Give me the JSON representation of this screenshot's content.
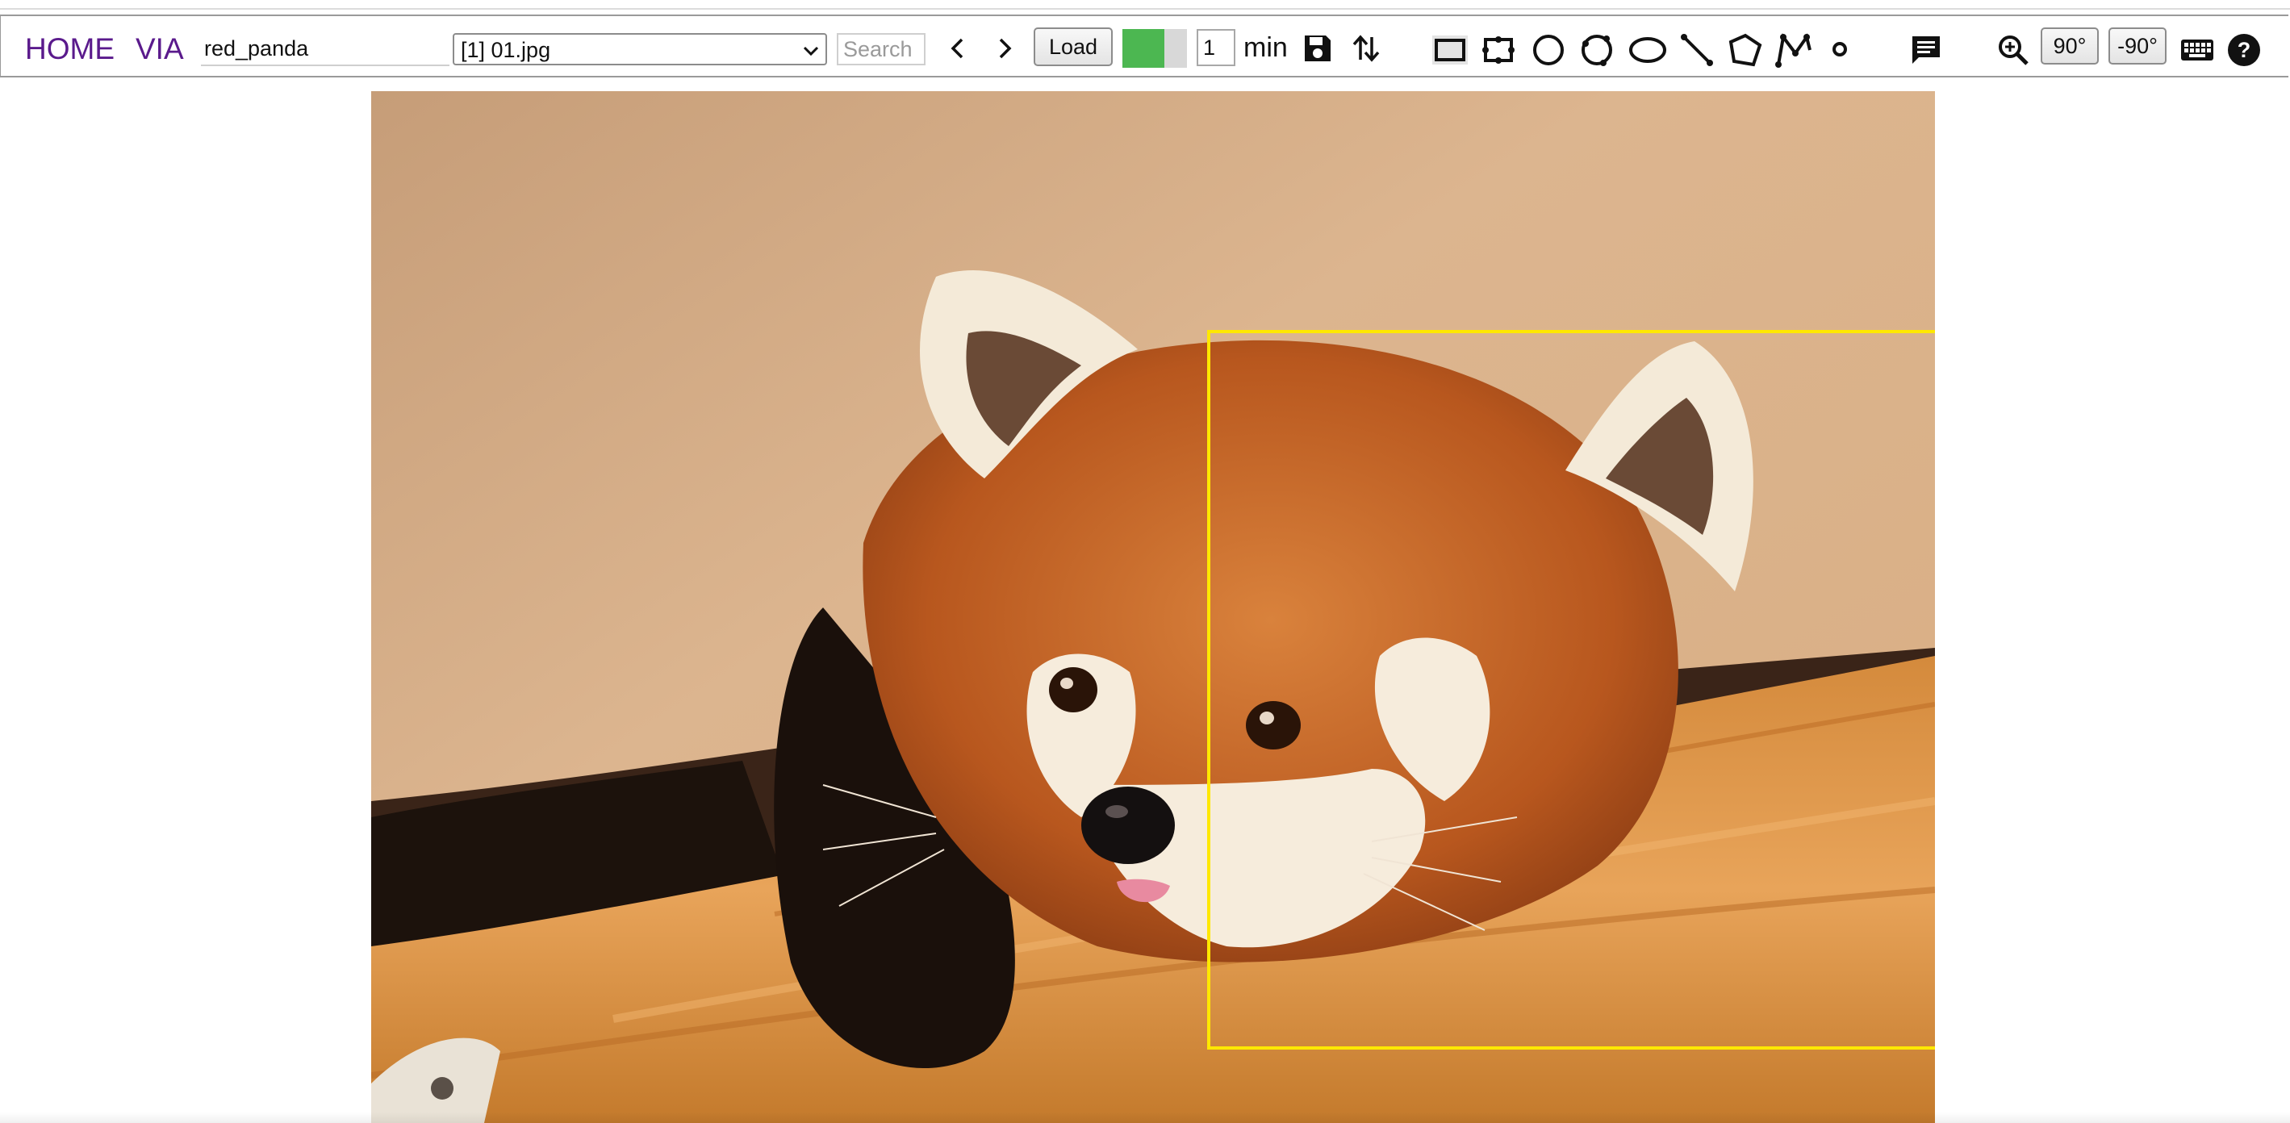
{
  "nav": {
    "home_label": "HOME",
    "via_label": "VIA"
  },
  "project": {
    "name_value": "red_panda"
  },
  "file_select": {
    "selected": "[1] 01.jpg"
  },
  "search": {
    "placeholder": "Search"
  },
  "toolbar": {
    "load_label": "Load",
    "region_color_primary": "#4cb751",
    "region_color_secondary": "#d8d8d8",
    "duration_value": "1",
    "duration_unit": "min",
    "rotate_cw_label": "90°",
    "rotate_ccw_label": "-90°",
    "icons": [
      "chevron-left-icon",
      "chevron-right-icon",
      "save-icon",
      "swap-vert-icon",
      "rectangle-shape-icon",
      "extreme-rectangle-shape-icon",
      "circle-shape-icon",
      "extreme-circle-shape-icon",
      "ellipse-shape-icon",
      "line-shape-icon",
      "polygon-shape-icon",
      "polyline-shape-icon",
      "point-shape-icon",
      "comment-icon",
      "zoom-in-icon",
      "keyboard-icon",
      "help-icon"
    ]
  },
  "image": {
    "subject": "red panda resting head on a log"
  },
  "annotation": {
    "region_shape": "rectangle",
    "stroke_color": "#ffe800"
  },
  "colors": {
    "nav_link": "#5a1a8c",
    "toolbar_border": "#9a9a9a"
  }
}
